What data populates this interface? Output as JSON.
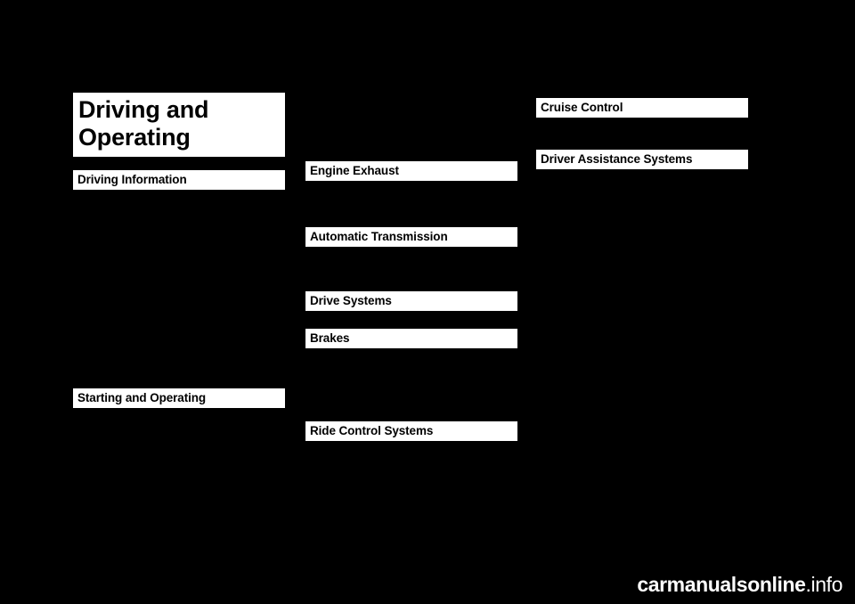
{
  "page": {
    "background_color": "#000000",
    "text_color": "#ffffff",
    "heading_bar_color": "#ffffff",
    "heading_text_color": "#000000"
  },
  "chapter": {
    "title_line1": "Driving and",
    "title_line2": "Operating"
  },
  "columns": {
    "left": [
      {
        "label": "Driving Information"
      },
      {
        "label": "Starting and Operating"
      }
    ],
    "middle": [
      {
        "label": "Engine Exhaust"
      },
      {
        "label": "Automatic Transmission"
      },
      {
        "label": "Drive Systems"
      },
      {
        "label": "Brakes"
      },
      {
        "label": "Ride Control Systems"
      }
    ],
    "right": [
      {
        "label": "Cruise Control"
      },
      {
        "label": "Driver Assistance Systems"
      }
    ]
  },
  "footer": {
    "watermark_part1": "carmanualsonline",
    "watermark_part2": ".info"
  }
}
